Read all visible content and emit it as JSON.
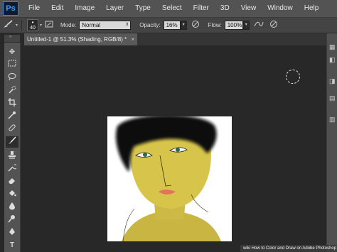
{
  "app": {
    "logo": "Ps"
  },
  "menu": [
    "File",
    "Edit",
    "Image",
    "Layer",
    "Type",
    "Select",
    "Filter",
    "3D",
    "View",
    "Window",
    "Help"
  ],
  "options": {
    "brush_size": "40",
    "mode_label": "Mode:",
    "mode_value": "Normal",
    "opacity_label": "Opacity:",
    "opacity_value": "16%",
    "flow_label": "Flow:",
    "flow_value": "100%"
  },
  "document": {
    "tab_title": "Untitled-1 @ 51.3% (Shading, RGB/8) *",
    "close_glyph": "×"
  },
  "tools": [
    "move-tool",
    "marquee-tool",
    "lasso-tool",
    "quick-selection-tool",
    "crop-tool",
    "eyedropper-tool",
    "spot-healing-tool",
    "brush-tool",
    "clone-stamp-tool",
    "history-brush-tool",
    "eraser-tool",
    "paint-bucket-tool",
    "blur-tool",
    "dodge-tool",
    "pen-tool",
    "type-tool"
  ],
  "watermark": "wiki How to Color and Draw on Adobe Photoshop",
  "colors": {
    "accent": "#35a5ff",
    "skin": "#d8c64a",
    "hair": "#111111"
  }
}
